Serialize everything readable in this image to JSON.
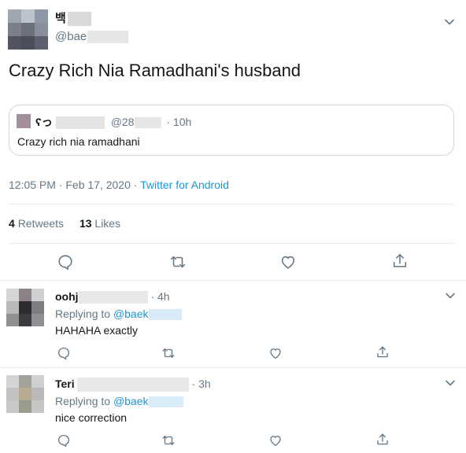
{
  "tweet": {
    "display_name": "백",
    "handle": "@bae",
    "text": "Crazy Rich Nia Ramadhani's husband",
    "timestamp": "12:05 PM · Feb 17, 2020 · ",
    "source": "Twitter for Android",
    "retweets_count": "4",
    "retweets_label": "Retweets",
    "likes_count": "13",
    "likes_label": "Likes"
  },
  "quoted": {
    "name_partial": "ʕっ",
    "handle_partial": "@28",
    "time": "· 10h",
    "text": "Crazy rich nia ramadhani"
  },
  "replies": [
    {
      "name_partial": "oohj",
      "time": "· 4h",
      "replying_prefix": "Replying to ",
      "replying_handle": "@baek",
      "text": "HAHAHA exactly"
    },
    {
      "name_partial": "Teri",
      "time": "· 3h",
      "replying_prefix": "Replying to ",
      "replying_handle": "@baek",
      "text": "nice correction"
    }
  ],
  "colors": {
    "link": "#1b95e0",
    "muted": "#657786",
    "divider": "#e6ecf0",
    "text": "#14171a"
  }
}
